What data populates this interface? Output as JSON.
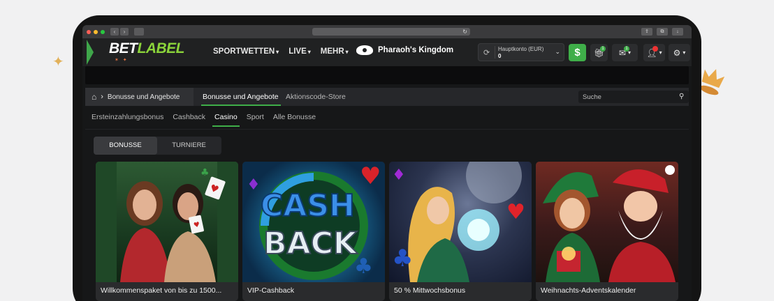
{
  "browser": {
    "reload_icon": "reload-icon"
  },
  "header": {
    "logo_bet": "BET",
    "logo_label": "LABEL",
    "nav": [
      {
        "label": "SPORTWETTEN"
      },
      {
        "label": "LIVE"
      },
      {
        "label": "MEHR"
      }
    ],
    "featured_game": "Pharaoh's Kingdom",
    "account": {
      "label": "Hauptkonto  (EUR)",
      "balance": "0"
    },
    "deposit_symbol": "$",
    "gift_badge": "1",
    "messages_badge": "1",
    "colors": {
      "accent": "#3fae49",
      "header_bg": "#202122",
      "page_bg": "#161718"
    }
  },
  "breadcrumb": {
    "current": "Bonusse und Angebote"
  },
  "top_tabs": [
    {
      "label": "Bonusse und Angebote",
      "active": true
    },
    {
      "label": "Aktionscode-Store",
      "active": false
    }
  ],
  "search": {
    "placeholder": "Suche"
  },
  "sub_tabs": [
    {
      "label": "Ersteinzahlungsbonus",
      "active": false
    },
    {
      "label": "Cashback",
      "active": false
    },
    {
      "label": "Casino",
      "active": true
    },
    {
      "label": "Sport",
      "active": false
    },
    {
      "label": "Alle Bonusse",
      "active": false
    }
  ],
  "segments": [
    {
      "label": "BONUSSE",
      "active": true
    },
    {
      "label": "TURNIERE",
      "active": false
    }
  ],
  "cards": [
    {
      "title": "Willkommenspaket von bis zu 1500..."
    },
    {
      "title": "VIP-Cashback",
      "image_text_1": "CASH",
      "image_text_2": "BACK"
    },
    {
      "title": "50 % Mittwochsbonus"
    },
    {
      "title": "Weihnachts-Adventskalender"
    }
  ]
}
